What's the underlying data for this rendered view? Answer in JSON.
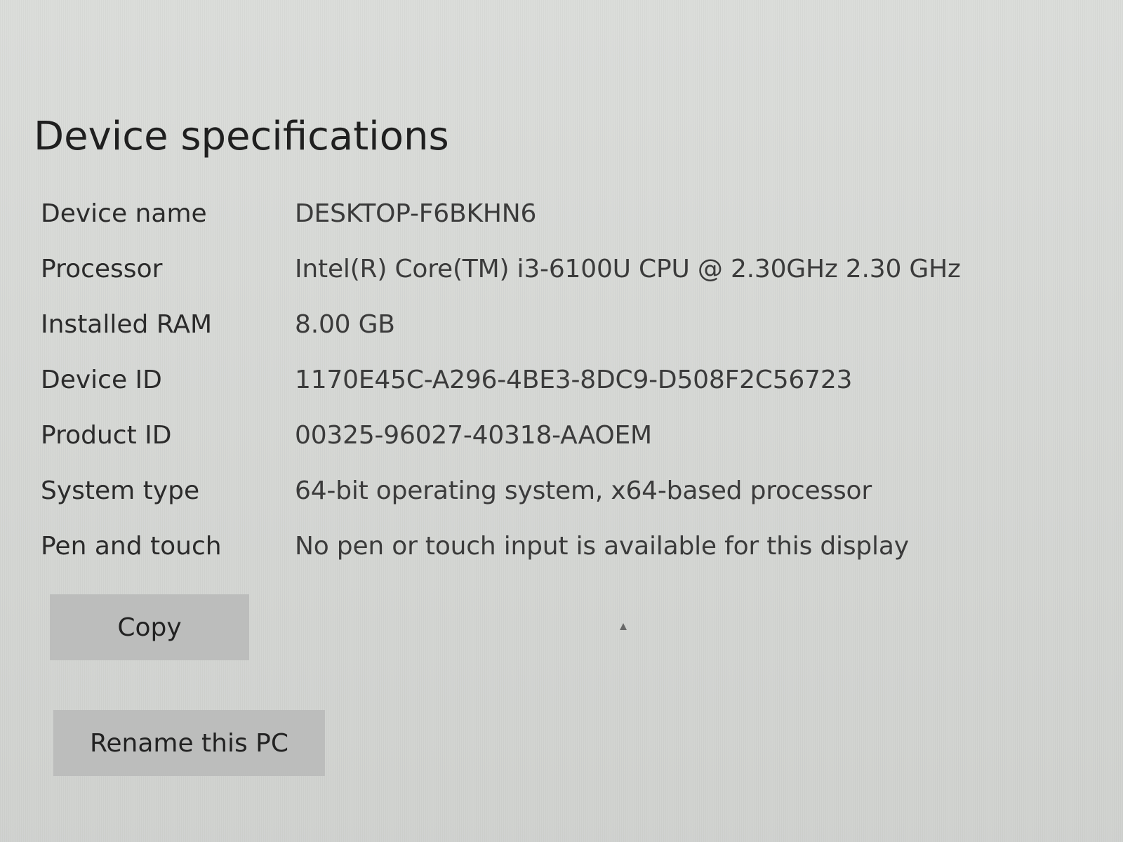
{
  "page": {
    "title": "Device specifications"
  },
  "specs": [
    {
      "label": "Device name",
      "value": "DESKTOP-F6BKHN6"
    },
    {
      "label": "Processor",
      "value": "Intel(R) Core(TM) i3-6100U CPU @ 2.30GHz   2.30 GHz"
    },
    {
      "label": "Installed RAM",
      "value": "8.00 GB"
    },
    {
      "label": "Device ID",
      "value": "1170E45C-A296-4BE3-8DC9-D508F2C56723"
    },
    {
      "label": "Product ID",
      "value": "00325-96027-40318-AAOEM"
    },
    {
      "label": "System type",
      "value": "64-bit operating system, x64-based processor"
    },
    {
      "label": "Pen and touch",
      "value": "No pen or touch input is available for this display"
    }
  ],
  "actions": {
    "copy_label": "Copy",
    "rename_label": "Rename this PC"
  },
  "colors": {
    "background": "#d9dbd8",
    "button_background": "#bcbdbc",
    "text": "#222222"
  },
  "icons": {
    "cursor": "mouse-cursor-icon"
  }
}
